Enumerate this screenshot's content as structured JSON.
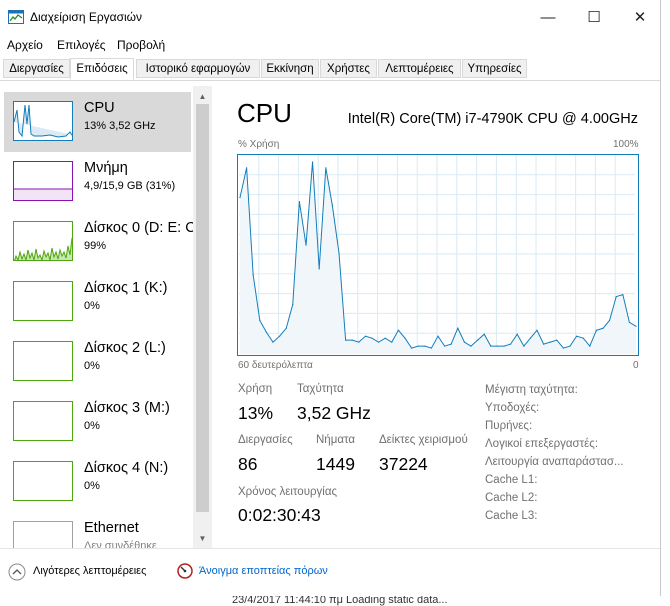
{
  "window": {
    "title": "Διαχείριση Εργασιών",
    "controls": {
      "minimize": "—",
      "maximize": "☐",
      "close": "✕"
    }
  },
  "menu": [
    "Αρχείο",
    "Επιλογές",
    "Προβολή"
  ],
  "tabs": [
    "Διεργασίες",
    "Επιδόσεις",
    "Ιστορικό εφαρμογών",
    "Εκκίνηση",
    "Χρήστες",
    "Λεπτομέρειες",
    "Υπηρεσίες"
  ],
  "active_tab": 1,
  "sidebar": {
    "items": [
      {
        "name": "CPU",
        "sub": "13% 3,52 GHz",
        "color": "#117dbb"
      },
      {
        "name": "Μνήμη",
        "sub": "4,9/15,9 GB (31%)",
        "color": "#8b12ae"
      },
      {
        "name": "Δίσκος 0 (D: E: C",
        "sub": "99%",
        "color": "#4da60c"
      },
      {
        "name": "Δίσκος 1 (K:)",
        "sub": "0%",
        "color": "#4da60c"
      },
      {
        "name": "Δίσκος 2 (L:)",
        "sub": "0%",
        "color": "#4da60c"
      },
      {
        "name": "Δίσκος 3 (M:)",
        "sub": "0%",
        "color": "#4da60c"
      },
      {
        "name": "Δίσκος 4 (N:)",
        "sub": "0%",
        "color": "#4da60c"
      },
      {
        "name": "Ethernet",
        "sub": "Δεν συνδέθηκε",
        "color": "#a0a0a0"
      }
    ]
  },
  "main": {
    "title": "CPU",
    "model": "Intel(R) Core(TM) i7-4790K CPU @ 4.00GHz",
    "usage_label": "% Χρήση",
    "max_label": "100%",
    "time_label": "60 δευτερόλεπτα",
    "min_label": "0",
    "stats": {
      "usage_label": "Χρήση",
      "usage": "13%",
      "speed_label": "Ταχύτητα",
      "speed": "3,52 GHz",
      "processes_label": "Διεργασίες",
      "processes": "86",
      "threads_label": "Νήματα",
      "threads": "1449",
      "handles_label": "Δείκτες χειρισμού",
      "handles": "37224",
      "uptime_label": "Χρόνος λειτουργίας",
      "uptime": "0:02:30:43"
    },
    "details": [
      "Μέγιστη ταχύτητα:",
      "Υποδοχές:",
      "Πυρήνες:",
      "Λογικοί επεξεργαστές:",
      "Λειτουργία αναπαράστασ...",
      "Cache L1:",
      "Cache L2:",
      "Cache L3:"
    ]
  },
  "chart_data": {
    "type": "line",
    "ylim": [
      0,
      100
    ],
    "values": [
      79,
      94,
      40,
      17,
      11,
      6,
      9,
      13,
      25,
      77,
      55,
      97,
      43,
      94,
      75,
      51,
      7,
      7,
      6,
      9,
      8,
      6,
      8,
      6,
      12,
      8,
      3,
      4,
      4,
      3,
      9,
      4,
      5,
      13,
      6,
      4,
      7,
      10,
      4,
      4,
      4,
      5,
      10,
      4,
      8,
      12,
      5,
      6,
      7,
      3,
      4,
      9,
      8,
      4,
      12,
      13,
      17,
      29,
      30,
      16,
      14
    ]
  },
  "footer": {
    "fewer_details": "Λιγότερες λεπτομέρειες",
    "open_monitor": "Άνοιγμα εποπτείας πόρων"
  },
  "background": {
    "behind_text": "23/4/2017 11:44:10 πμ   Loading static data..."
  }
}
